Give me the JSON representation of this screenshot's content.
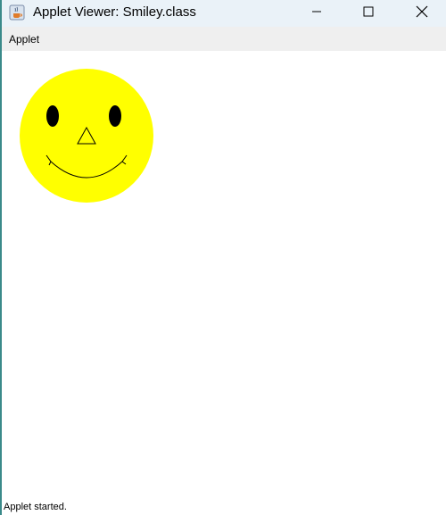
{
  "window": {
    "title": "Applet Viewer: Smiley.class",
    "app_icon": "java-coffee-cup-icon",
    "controls": {
      "minimize_icon": "minimize-icon",
      "maximize_icon": "maximize-icon",
      "close_icon": "close-icon"
    }
  },
  "menubar": {
    "items": [
      {
        "label": "Applet"
      }
    ]
  },
  "applet": {
    "drawing": "smiley-face",
    "face_color": "#ffff00",
    "feature_color": "#000000"
  },
  "status": {
    "text": "Applet started."
  },
  "colors": {
    "titlebar_bg": "#eaf2f8",
    "menubar_bg": "#efefef",
    "canvas_bg": "#ffffff"
  }
}
